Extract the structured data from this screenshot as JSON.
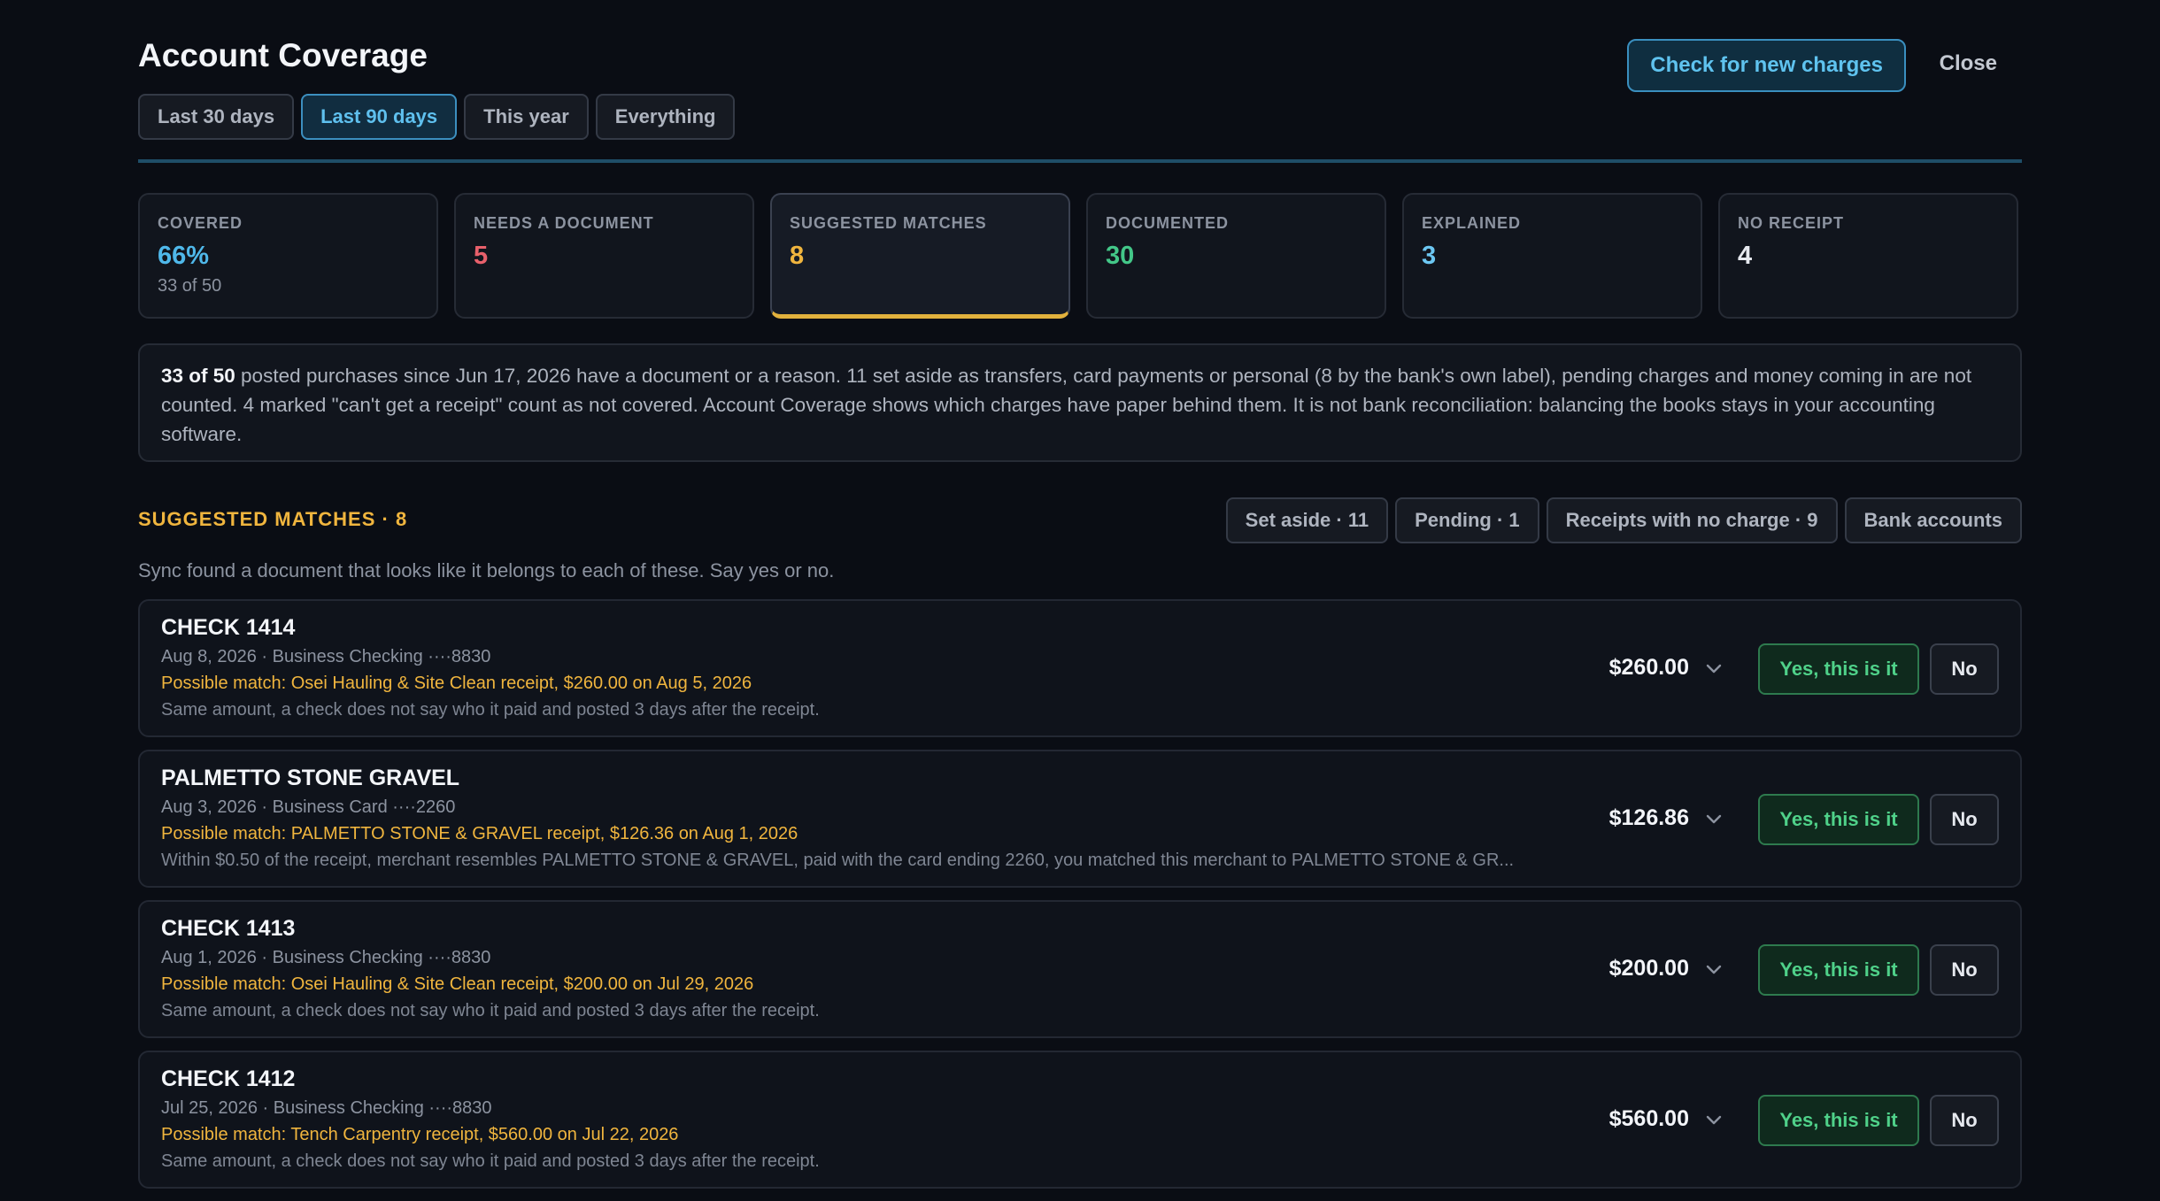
{
  "header": {
    "title": "Account Coverage",
    "tabs": [
      "Last 30 days",
      "Last 90 days",
      "This year",
      "Everything"
    ],
    "active_tab": "Last 90 days",
    "check_button": "Check for new charges",
    "close_button": "Close"
  },
  "stats": [
    {
      "label": "COVERED",
      "value": "66%",
      "sub": "33 of 50",
      "color": "#4fb8ea"
    },
    {
      "label": "NEEDS A DOCUMENT",
      "value": "5",
      "sub": "",
      "color": "#e8606b"
    },
    {
      "label": "SUGGESTED MATCHES",
      "value": "8",
      "sub": "",
      "color": "#f0b53e"
    },
    {
      "label": "DOCUMENTED",
      "value": "30",
      "sub": "",
      "color": "#43c788"
    },
    {
      "label": "EXPLAINED",
      "value": "3",
      "sub": "",
      "color": "#6cc7f2"
    },
    {
      "label": "NO RECEIPT",
      "value": "4",
      "sub": "",
      "color": "#e6e9ef"
    }
  ],
  "notice": {
    "bold": "33 of 50",
    "text": " posted purchases since Jun 17, 2026 have a document or a reason. 11 set aside as transfers, card payments or personal (8 by the bank's own label), pending charges and money coming in are not counted. 4 marked \"can't get a receipt\" count as not covered. Account Coverage shows which charges have paper behind them. It is not bank reconciliation: balancing the books stays in your accounting software."
  },
  "section": {
    "title": "SUGGESTED MATCHES · 8",
    "description": "Sync found a document that looks like it belongs to each of these. Say yes or no.",
    "buttons": [
      "Set aside · 11",
      "Pending · 1",
      "Receipts with no charge · 9",
      "Bank accounts"
    ]
  },
  "rows": [
    {
      "name": "CHECK 1414",
      "meta": "Aug 8, 2026 · Business Checking ····8830",
      "match": "Possible match: Osei Hauling & Site Clean receipt, $260.00 on Aug 5, 2026",
      "reason": "Same amount, a check does not say who it paid and posted 3 days after the receipt.",
      "amount": "$260.00",
      "yes": "Yes, this is it",
      "no": "No"
    },
    {
      "name": "PALMETTO STONE GRAVEL",
      "meta": "Aug 3, 2026 · Business Card ····2260",
      "match": "Possible match: PALMETTO STONE & GRAVEL receipt, $126.36 on Aug 1, 2026",
      "reason": "Within $0.50 of the receipt, merchant resembles PALMETTO STONE & GRAVEL, paid with the card ending 2260, you matched this merchant to PALMETTO STONE & GR...",
      "amount": "$126.86",
      "yes": "Yes, this is it",
      "no": "No"
    },
    {
      "name": "CHECK 1413",
      "meta": "Aug 1, 2026 · Business Checking ····8830",
      "match": "Possible match: Osei Hauling & Site Clean receipt, $200.00 on Jul 29, 2026",
      "reason": "Same amount, a check does not say who it paid and posted 3 days after the receipt.",
      "amount": "$200.00",
      "yes": "Yes, this is it",
      "no": "No"
    },
    {
      "name": "CHECK 1412",
      "meta": "Jul 25, 2026 · Business Checking ····8830",
      "match": "Possible match: Tench Carpentry receipt, $560.00 on Jul 22, 2026",
      "reason": "Same amount, a check does not say who it paid and posted 3 days after the receipt.",
      "amount": "$560.00",
      "yes": "Yes, this is it",
      "no": "No"
    }
  ]
}
